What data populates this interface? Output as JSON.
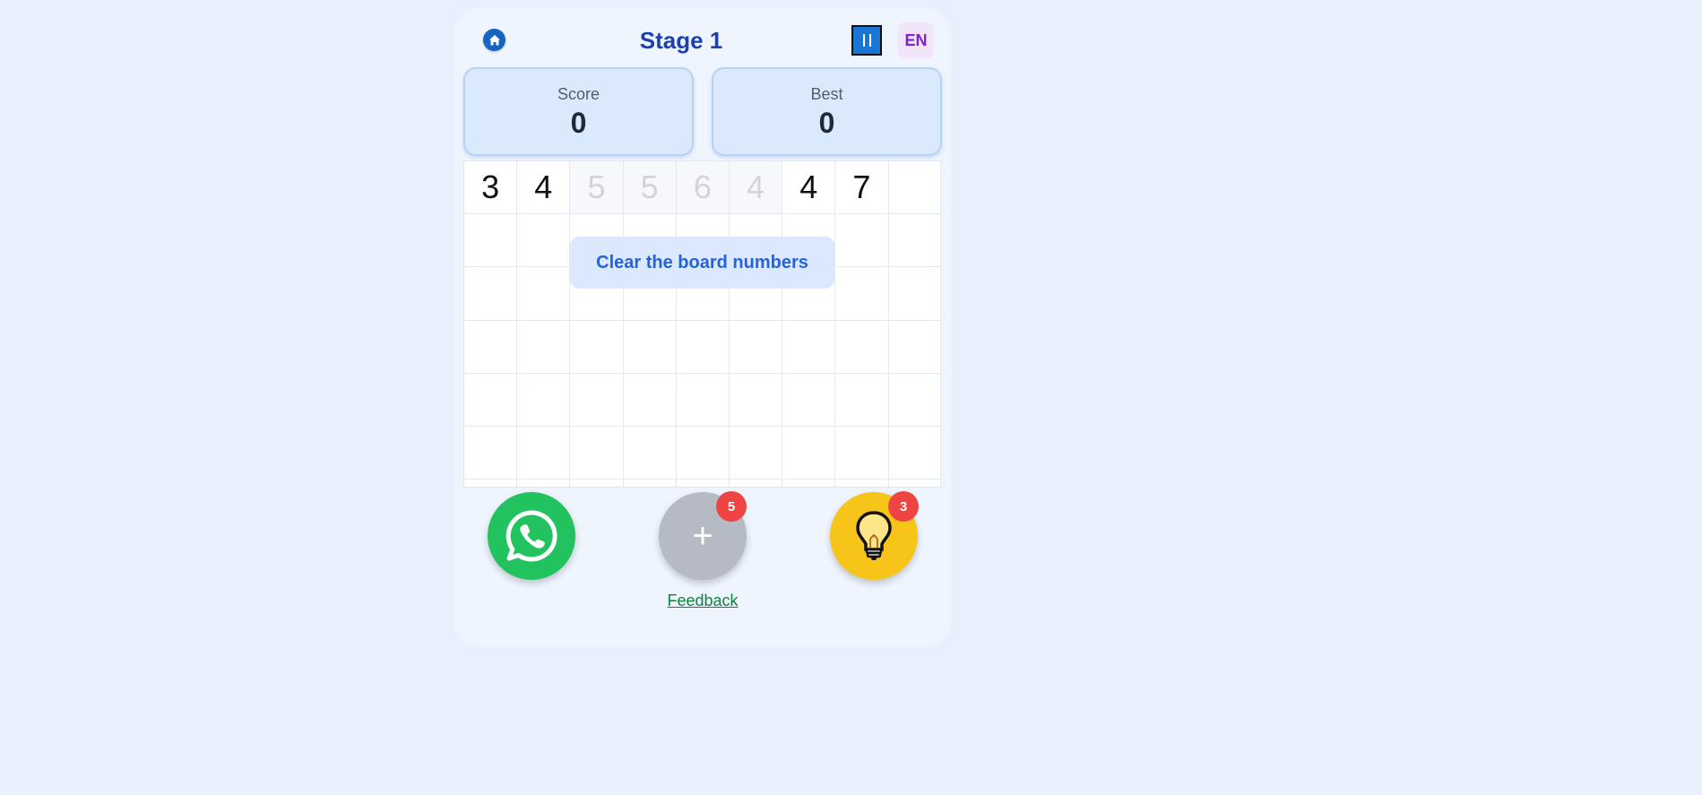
{
  "header": {
    "home_icon": "home-icon",
    "title": "Stage 1",
    "pause_icon": "pause-icon",
    "language": "EN"
  },
  "stats": {
    "score_label": "Score",
    "score_value": "0",
    "best_label": "Best",
    "best_value": "0"
  },
  "board": {
    "columns": 9,
    "rows": [
      [
        {
          "v": "3",
          "cleared": false
        },
        {
          "v": "4",
          "cleared": false
        },
        {
          "v": "5",
          "cleared": true
        },
        {
          "v": "5",
          "cleared": true
        },
        {
          "v": "6",
          "cleared": true
        },
        {
          "v": "4",
          "cleared": true
        },
        {
          "v": "4",
          "cleared": false
        },
        {
          "v": "7",
          "cleared": false
        },
        {
          "v": "",
          "cleared": false
        }
      ],
      [
        {
          "v": ""
        },
        {
          "v": ""
        },
        {
          "v": ""
        },
        {
          "v": ""
        },
        {
          "v": ""
        },
        {
          "v": ""
        },
        {
          "v": ""
        },
        {
          "v": ""
        },
        {
          "v": ""
        }
      ],
      [
        {
          "v": ""
        },
        {
          "v": ""
        },
        {
          "v": ""
        },
        {
          "v": ""
        },
        {
          "v": ""
        },
        {
          "v": ""
        },
        {
          "v": ""
        },
        {
          "v": ""
        },
        {
          "v": ""
        }
      ],
      [
        {
          "v": ""
        },
        {
          "v": ""
        },
        {
          "v": ""
        },
        {
          "v": ""
        },
        {
          "v": ""
        },
        {
          "v": ""
        },
        {
          "v": ""
        },
        {
          "v": ""
        },
        {
          "v": ""
        }
      ],
      [
        {
          "v": ""
        },
        {
          "v": ""
        },
        {
          "v": ""
        },
        {
          "v": ""
        },
        {
          "v": ""
        },
        {
          "v": ""
        },
        {
          "v": ""
        },
        {
          "v": ""
        },
        {
          "v": ""
        }
      ],
      [
        {
          "v": ""
        },
        {
          "v": ""
        },
        {
          "v": ""
        },
        {
          "v": ""
        },
        {
          "v": ""
        },
        {
          "v": ""
        },
        {
          "v": ""
        },
        {
          "v": ""
        },
        {
          "v": ""
        }
      ],
      [
        {
          "v": ""
        },
        {
          "v": ""
        },
        {
          "v": ""
        },
        {
          "v": ""
        },
        {
          "v": ""
        },
        {
          "v": ""
        },
        {
          "v": ""
        },
        {
          "v": ""
        },
        {
          "v": ""
        }
      ]
    ]
  },
  "toast": "Clear the board numbers",
  "actions": {
    "share_icon": "whatsapp-icon",
    "add_label": "+",
    "add_count": "5",
    "hint_icon": "lightbulb-icon",
    "hint_count": "3"
  },
  "feedback": "Feedback",
  "colors": {
    "primary": "#1e40af",
    "whatsapp": "#22c35e",
    "hint": "#f7c41a",
    "badge": "#ef4444"
  }
}
